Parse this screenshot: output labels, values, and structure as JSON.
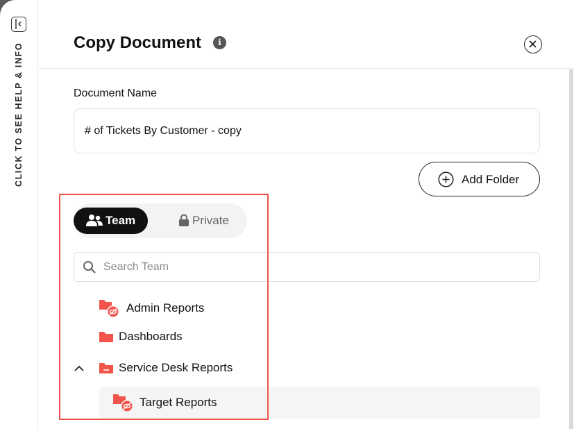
{
  "sidebar": {
    "help_text": "CLICK TO SEE HELP & INFO"
  },
  "modal": {
    "title": "Copy Document",
    "document_name_label": "Document Name",
    "document_name_value": "# of Tickets By Customer - copy",
    "add_folder_label": "Add Folder"
  },
  "tabs": {
    "team_label": "Team",
    "private_label": "Private",
    "selected": "Team"
  },
  "search": {
    "placeholder": "Search Team"
  },
  "folders": [
    {
      "label": "Admin Reports",
      "icon": "folder-hidden-icon"
    },
    {
      "label": "Dashboards",
      "icon": "folder-icon"
    },
    {
      "label": "Service Desk Reports",
      "icon": "folder-open-icon",
      "expanded": true
    },
    {
      "label": "Target Reports",
      "icon": "folder-hidden-icon",
      "selected": true
    }
  ],
  "colors": {
    "accent": "#f2544b",
    "folder": "#f2544b",
    "dark": "#111111"
  }
}
